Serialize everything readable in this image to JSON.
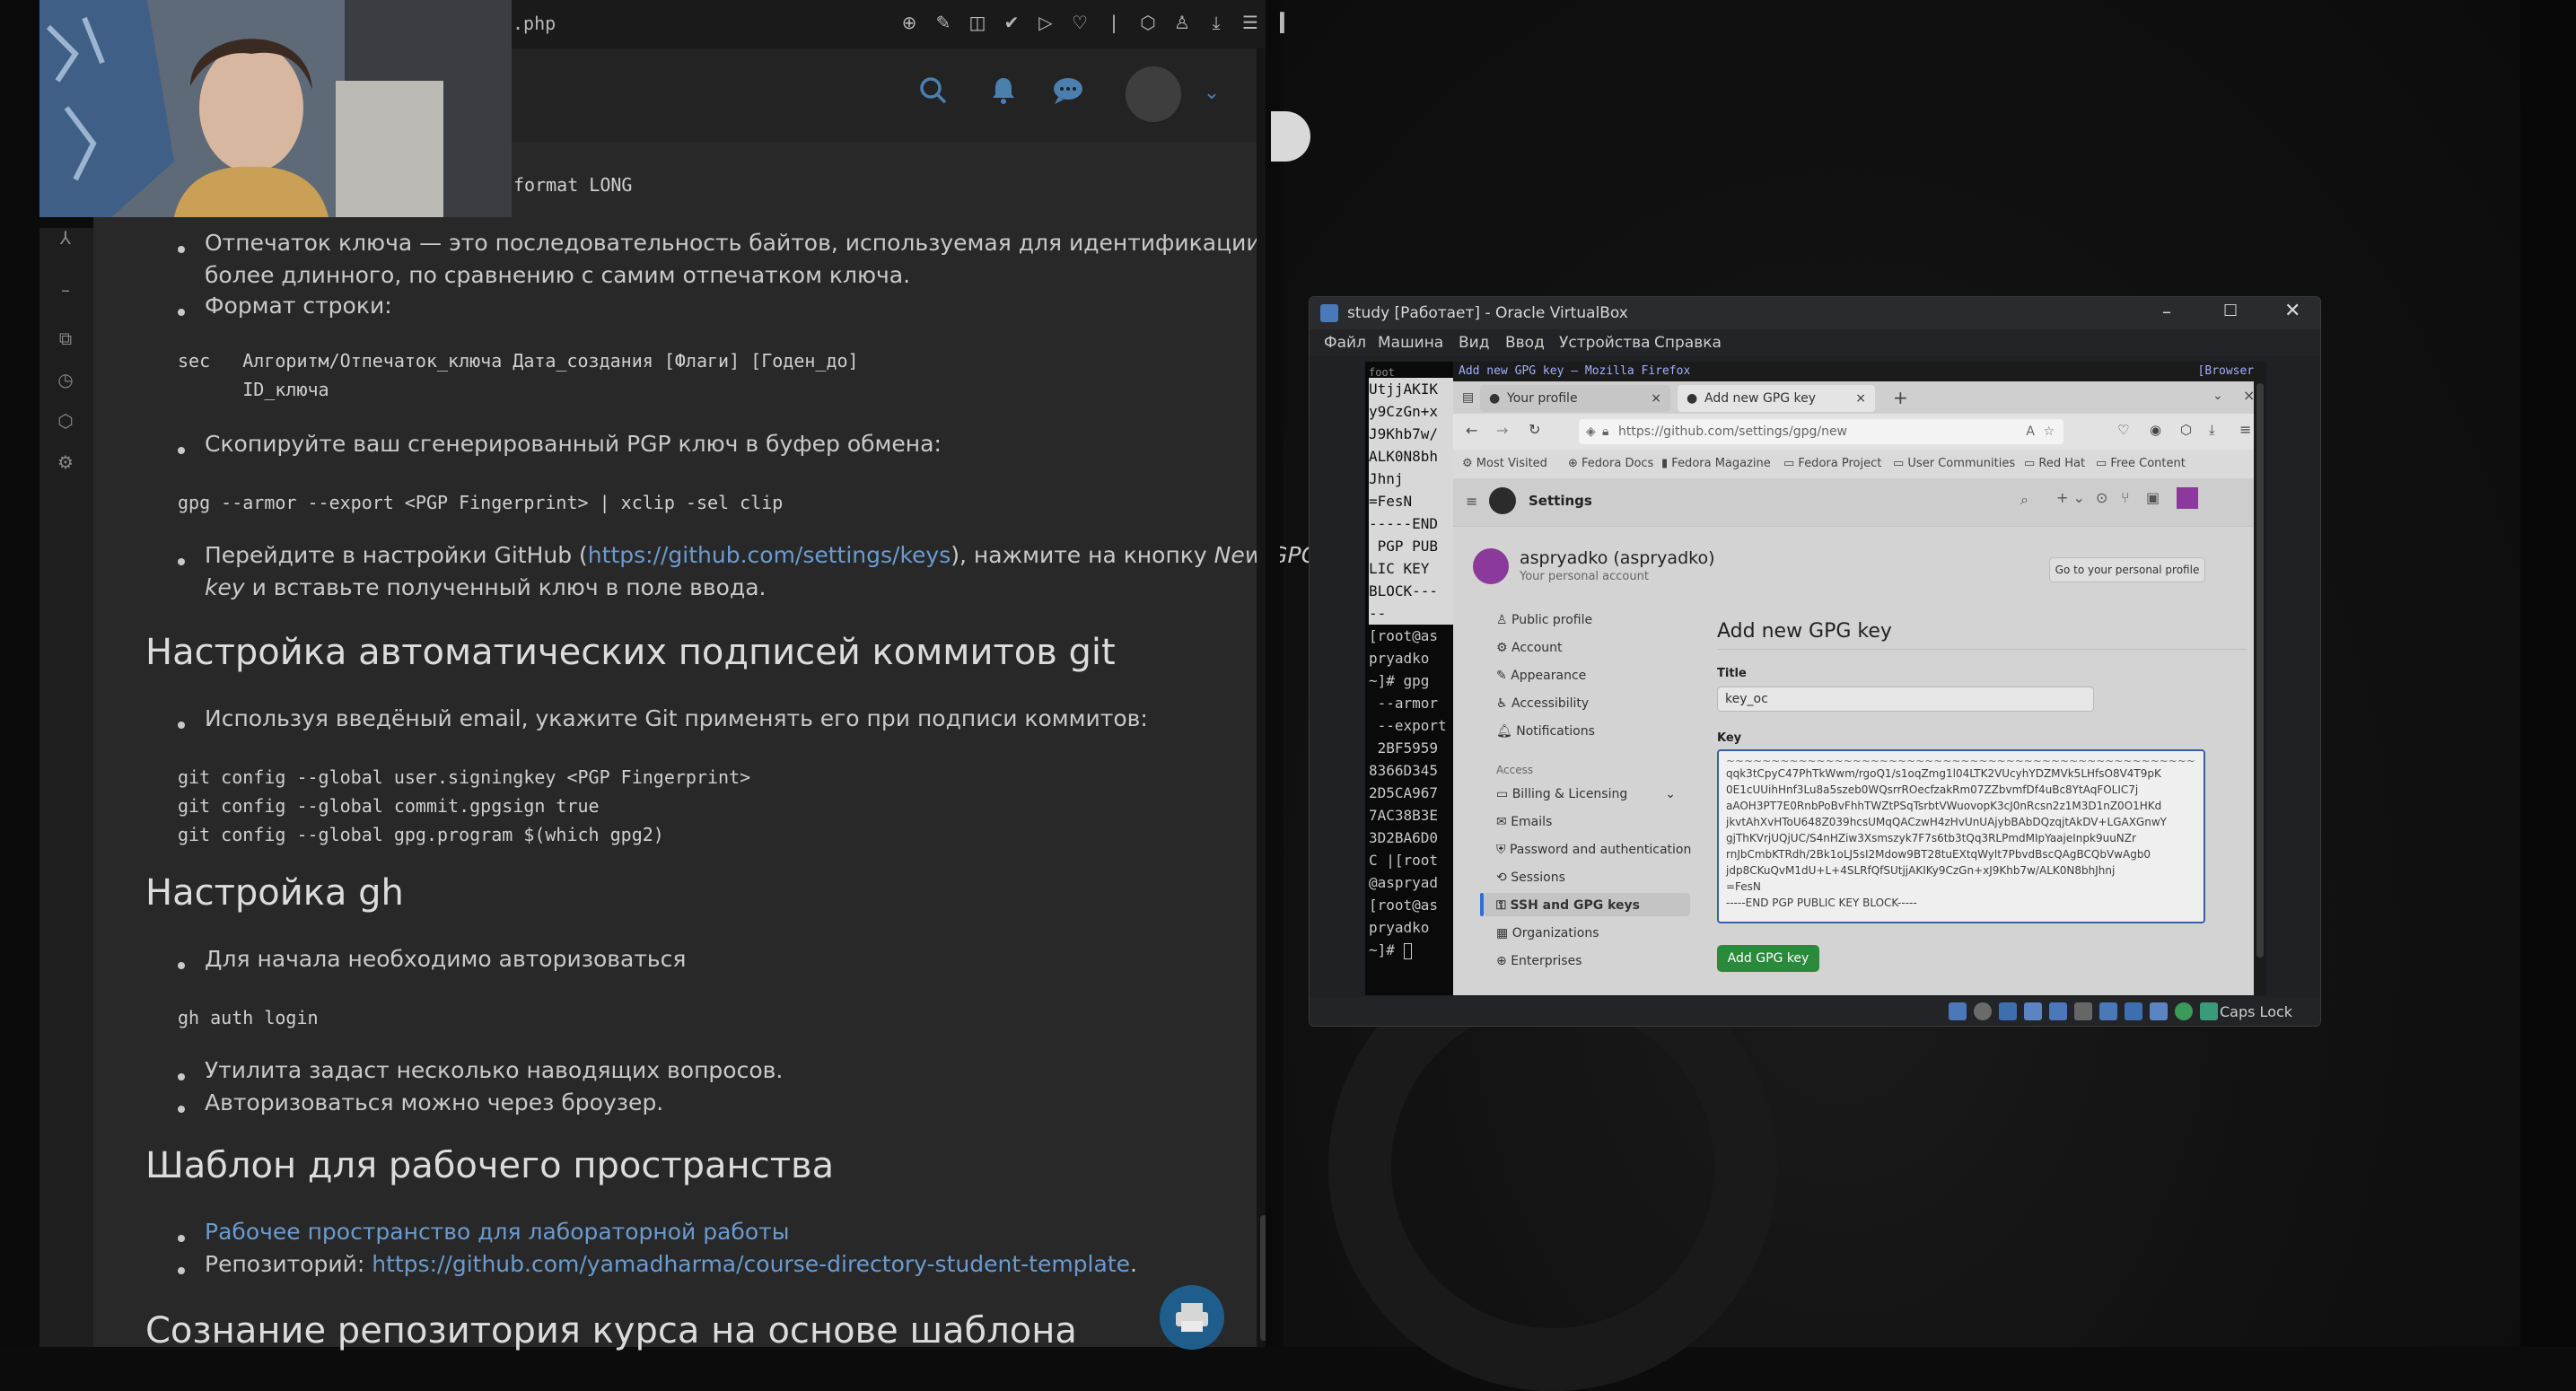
{
  "left_window": {
    "url_fragment": ".php",
    "content": {
      "code_format_long": "format LONG",
      "bullet_fingerprint": "Отпечаток ключа — это последовательность байтов, используемая для идентификации",
      "bullet_fingerprint_2": "более длинного, по сравнению с самим отпечатком ключа.",
      "bullet_format": "Формат строки:",
      "code_sec_1": "sec   Алгоритм/Отпечаток_ключа Дата_создания [Флаги] [Годен_до]",
      "code_sec_2": "      ID_ключа",
      "bullet_copy": "Скопируйте ваш сгенерированный PGP ключ в буфер обмена:",
      "code_gpg_export": "gpg --armor --export <PGP Fingerprint> | xclip -sel clip",
      "bullet_github_pre": "Перейдите в настройки GitHub (",
      "bullet_github_link": "https://github.com/settings/keys",
      "bullet_github_mid": "), нажмите на кнопку ",
      "bullet_github_em": "New GPG",
      "bullet_github_em2": "key",
      "bullet_github_post": " и вставьте полученный ключ в поле ввода.",
      "heading_autosign": "Настройка автоматических подписей коммитов git",
      "bullet_email": "Используя введёный email, укажите Git применять его при подписи коммитов:",
      "code_git_1": "git config --global user.signingkey <PGP Fingerprint>",
      "code_git_2": "git config --global commit.gpgsign true",
      "code_git_3": "git config --global gpg.program $(which gpg2)",
      "heading_gh": "Настройка gh",
      "bullet_auth": "Для начала необходимо авторизоваться",
      "code_gh_auth": "gh auth login",
      "bullet_questions": "Утилита задаст несколько наводящих вопросов.",
      "bullet_browser": "Авторизоваться можно через броузер.",
      "heading_template": "Шаблон для рабочего пространства",
      "link_workspace": "Рабочее пространство для лабораторной работы",
      "bullet_repo_label": "Репозиторий: ",
      "link_repo": "https://github.com/yamadharma/course-directory-student-template",
      "repo_period": ".",
      "heading_create": "Сознание репозитория курса на основе шаблона"
    }
  },
  "virtualbox": {
    "title": "study [Работает] - Oracle VirtualBox",
    "menu": [
      "Файл",
      "Машина",
      "Вид",
      "Ввод",
      "Устройства",
      "Справка"
    ],
    "caps_lock": "Caps Lock",
    "terminal": {
      "label": "foot",
      "lines": [
        "UtjjAKIK",
        "y9CzGn+x",
        "J9Khb7w/",
        "ALK0N8bh",
        "Jhnj",
        "=FesN",
        "-----END",
        " PGP PUB",
        "LIC KEY ",
        "BLOCK---",
        "--",
        "[root@as",
        "pryadko ",
        "~]# gpg ",
        " --armor",
        " --export",
        " 2BF5959",
        "8366D345",
        "2D5CA967",
        "7AC38B3E",
        "3D2BA6D0",
        "C |[root",
        "@aspryad",
        "[root@as",
        "pryadko ",
        "~]# "
      ]
    },
    "firefox": {
      "title_bar": "Add new GPG key — Mozilla Firefox",
      "title_right": "[Browser]",
      "tabs": [
        "Your profile",
        "Add new GPG key"
      ],
      "url": "https://github.com/settings/gpg/new",
      "bookmarks": [
        "Most Visited",
        "Fedora Docs",
        "Fedora Magazine",
        "Fedora Project",
        "User Communities",
        "Red Hat",
        "Free Content"
      ],
      "github": {
        "settings_label": "Settings",
        "user_name": "aspryadko (aspryadko)",
        "user_sub": "Your personal account",
        "profile_button": "Go to your personal profile",
        "sidebar": [
          "Public profile",
          "Account",
          "Appearance",
          "Accessibility",
          "Notifications"
        ],
        "access_label": "Access",
        "access_items": [
          "Billing & Licensing",
          "Emails",
          "Password and authentication",
          "Sessions",
          "SSH and GPG keys",
          "Organizations",
          "Enterprises"
        ],
        "heading": "Add new GPG key",
        "title_label": "Title",
        "title_value": "key_oc",
        "key_label": "Key",
        "key_lines": [
          "qqk3tCpyC47PhTkWwm/rgoQ1/s1oqZmg1l04LTK2VUcyhYDZMVk5LHfsO8V4T9pK",
          "0E1cUUihHnf3Lu8a5szeb0WQsrrROecfzakRm07ZZbvmfDf4uBc8YtAqFOLIC7j",
          "aAOH3PT7E0RnbPoBvFhhTWZtPSqTsrbtVWuovopK3cJ0nRcsn2z1M3D1nZ0O1HKd",
          "jkvtAhXvHToU648Z039hcsUMqQACzwH4zHvUnUAjybBAbDQzqjtAkDV+LGAXGnwY",
          "gjThKVrjUQjUC/S4nHZiw3Xsmszyk7F7s6tb3tQq3RLPmdMIpYaajeInpk9uuNZr",
          "rnJbCmbKTRdh/2Bk1oLJ5sI2Mdow9BT28tuEXtqWylt7PbvdBscQAgBCQbVwAgb0",
          "jdp8CKuQvM1dU+L+4SLRfQfSUtjjAKIKy9CzGn+xJ9Khb7w/ALK0N8bhJhnj",
          "=FesN",
          "-----END PGP PUBLIC KEY BLOCK-----"
        ],
        "add_button": "Add GPG key"
      }
    }
  }
}
